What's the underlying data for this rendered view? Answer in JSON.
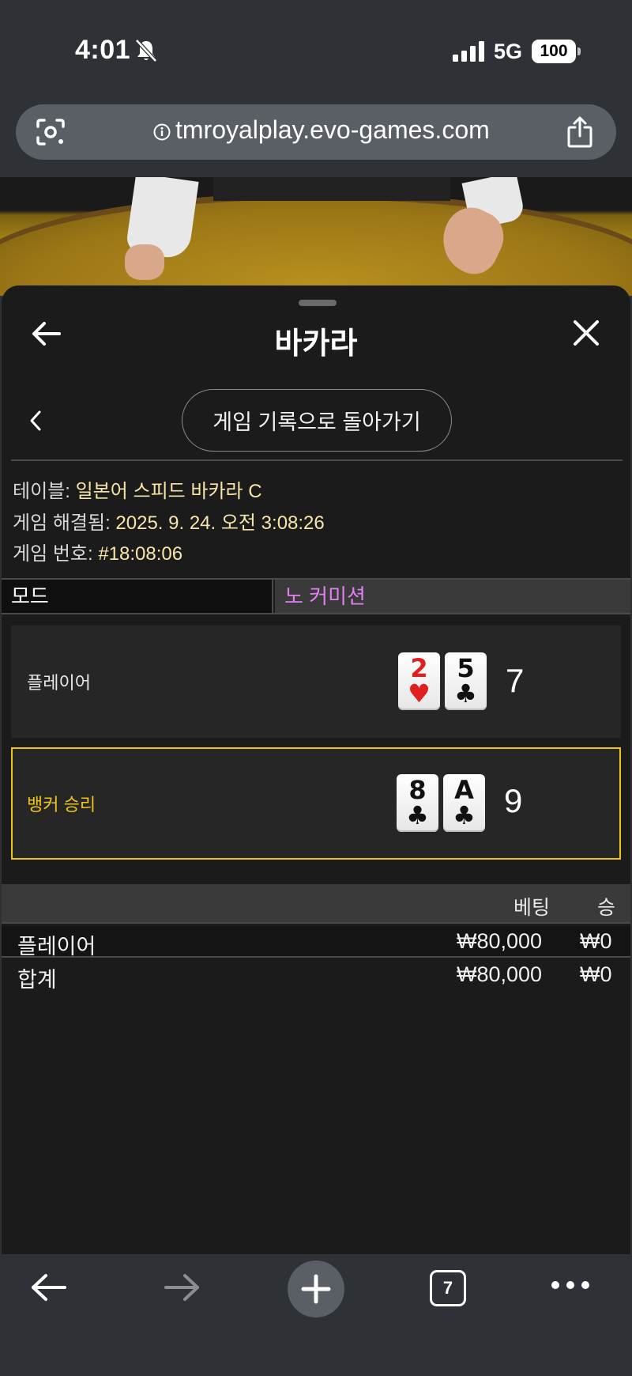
{
  "status_bar": {
    "time": "4:01",
    "network": "5G",
    "battery": "100"
  },
  "browser": {
    "url": "tmroyalplay.evo-games.com"
  },
  "sheet": {
    "title": "바카라",
    "return_button": "게임 기록으로 돌아가기",
    "info": {
      "table_label": "테이블: ",
      "table_value": "일본어 스피드 바카라 C",
      "resolved_label": "게임 해결됨: ",
      "resolved_value": "2025. 9. 24. 오전 3:08:26",
      "round_label": "게임 번호: ",
      "round_value": "#18:08:06"
    },
    "mode": {
      "label": "모드",
      "value": "노 커미션"
    },
    "hands": {
      "player": {
        "label": "플레이어",
        "cards": [
          {
            "rank": "2",
            "suit": "♥",
            "color": "red"
          },
          {
            "rank": "5",
            "suit": "♣",
            "color": "black"
          }
        ],
        "score": "7"
      },
      "banker": {
        "label": "뱅커 승리",
        "cards": [
          {
            "rank": "8",
            "suit": "♣",
            "color": "black"
          },
          {
            "rank": "A",
            "suit": "♣",
            "color": "black"
          }
        ],
        "score": "9"
      }
    },
    "bets": {
      "headers": {
        "bet": "베팅",
        "win": "승"
      },
      "rows": [
        {
          "name": "플레이어",
          "bet": "₩80,000",
          "win": "₩0"
        },
        {
          "name": "합계",
          "bet": "₩80,000",
          "win": "₩0"
        }
      ]
    },
    "colors": {
      "accent_yellow": "#f0c419",
      "mode_purple": "#e080f0",
      "info_value": "#f7e6a8"
    }
  },
  "toolbar": {
    "tab_count": "7"
  }
}
